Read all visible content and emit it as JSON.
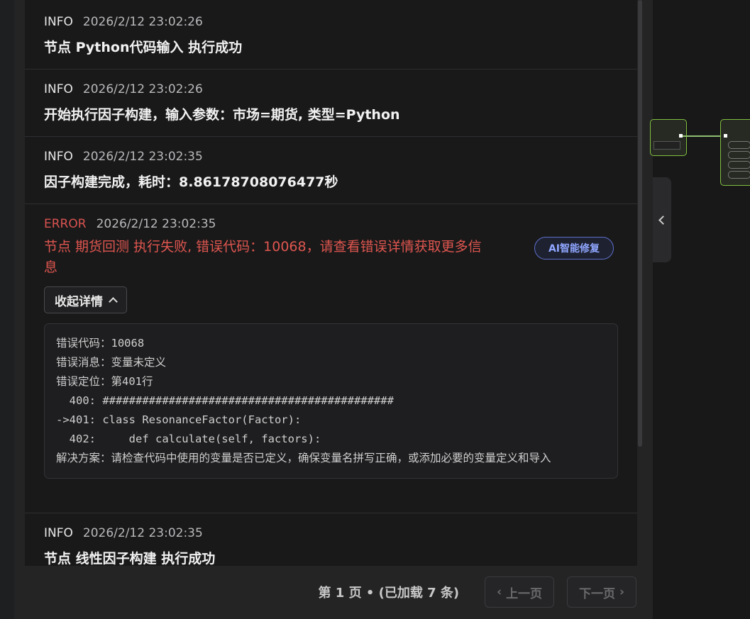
{
  "logs": [
    {
      "level": "INFO",
      "time": "2026/2/12 23:02:26",
      "message": "节点 Python代码输入 执行成功"
    },
    {
      "level": "INFO",
      "time": "2026/2/12 23:02:26",
      "message": "开始执行因子构建，输入参数：市场=期货, 类型=Python"
    },
    {
      "level": "INFO",
      "time": "2026/2/12 23:02:35",
      "message": "因子构建完成，耗时：8.86178708076477秒"
    },
    {
      "level": "ERROR",
      "time": "2026/2/12 23:02:35",
      "message": "节点 期货回测 执行失败, 错误代码：10068，请查看错误详情获取更多信息",
      "ai_fix_label": "AI智能修复",
      "collapse_label": "收起详情",
      "details": "错误代码：10068\n错误消息：变量未定义\n错误定位：第401行\n  400: ############################################\n->401: class ResonanceFactor(Factor):\n  402:     def calculate(self, factors):\n解决方案：请检查代码中使用的变量是否已定义，确保变量名拼写正确，或添加必要的变量定义和导入"
    },
    {
      "level": "INFO",
      "time": "2026/2/12 23:02:35",
      "message": "节点 线性因子构建 执行成功"
    }
  ],
  "pagination": {
    "info": "第 1 页 • (已加载 7 条)",
    "prev_label": "上一页",
    "next_label": "下一页"
  },
  "colors": {
    "error": "#e0564f",
    "accent": "#8fa6ff",
    "node_border": "#7fbf3f"
  }
}
